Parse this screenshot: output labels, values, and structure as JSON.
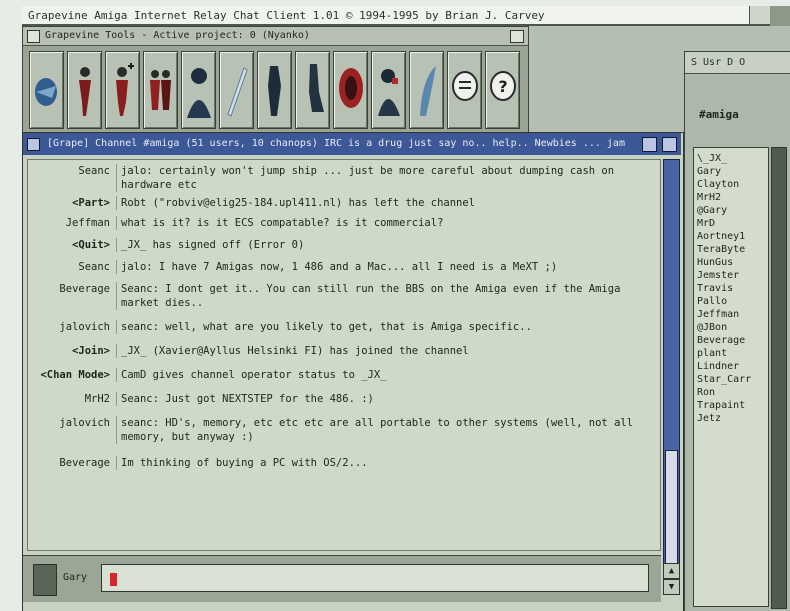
{
  "app": {
    "title": "Grapevine Amiga Internet Relay Chat Client 1.01 © 1994-1995 by Brian J. Carvey"
  },
  "tools_window": {
    "title": "Grapevine Tools - Active project: 0 (Nyanko)",
    "tools": [
      {
        "icon": "connect-icon"
      },
      {
        "icon": "user-icon"
      },
      {
        "icon": "user-add-icon"
      },
      {
        "icon": "group-icon"
      },
      {
        "icon": "profile-icon"
      },
      {
        "icon": "pen-icon"
      },
      {
        "icon": "person-icon"
      },
      {
        "icon": "leg-icon"
      },
      {
        "icon": "face-red-icon"
      },
      {
        "icon": "operator-icon"
      },
      {
        "icon": "feather-icon"
      },
      {
        "icon": "chat-bubble-icon"
      },
      {
        "icon": "help-icon"
      }
    ]
  },
  "side_panel": {
    "header": "S Usr D O",
    "channel_label": "#amiga",
    "nicks": [
      "\\_JX_",
      "Gary",
      "Clayton",
      "MrH2",
      "@Gary",
      "MrD",
      "Aortney1",
      "TeraByte",
      "HunGus",
      "Jemster",
      "Travis",
      "Pallo",
      "Jeffman",
      "@JBon",
      "Beverage",
      "plant",
      "Lindner",
      "Star_Carr",
      "Ron",
      "Trapaint",
      "Jetz"
    ]
  },
  "chat": {
    "title": "[Grape] Channel #amiga (51 users, 10 chanops) IRC is a drug just say no.. help.. Newbies ... jam",
    "messages": [
      {
        "nick": "Seanc",
        "text": "jalo: certainly won't jump ship ... just be more careful about dumping cash on hardware etc",
        "system": false
      },
      {
        "nick": "<Part>",
        "text": "Robt (\"robviv@elig25-184.upl411.nl) has left the channel",
        "system": true
      },
      {
        "nick": "Jeffman",
        "text": "what is it? is it ECS compatable? is it commercial?",
        "system": false
      },
      {
        "nick": "<Quit>",
        "text": "_JX_ has signed off (Error 0)",
        "system": true
      },
      {
        "nick": "Seanc",
        "text": "jalo: I have 7 Amigas now, 1 486 and a Mac... all I need is a MeXT ;)",
        "system": false
      },
      {
        "nick": "Beverage",
        "text": "Seanc: I dont get it.. You can still run the BBS on the Amiga even if the Amiga market dies..",
        "system": false
      },
      {
        "nick": "jalovich",
        "text": "seanc: well, what are you likely to get, that is Amiga specific..",
        "system": false
      },
      {
        "nick": "<Join>",
        "text": "_JX_ (Xavier@Ayllus Helsinki FI) has joined the channel",
        "system": true
      },
      {
        "nick": "<Chan Mode>",
        "text": "CamD gives channel operator status to _JX_",
        "system": true
      },
      {
        "nick": "MrH2",
        "text": "Seanc: Just got NEXTSTEP for the 486. :)",
        "system": false
      },
      {
        "nick": "jalovich",
        "text": "seanc: HD's, memory, etc etc etc are all portable to other systems (well, not all memory, but anyway :)",
        "system": false
      },
      {
        "nick": "Beverage",
        "text": "Im thinking of buying a PC with OS/2...",
        "system": false
      }
    ]
  },
  "input": {
    "user_label": "Gary",
    "value": ""
  }
}
